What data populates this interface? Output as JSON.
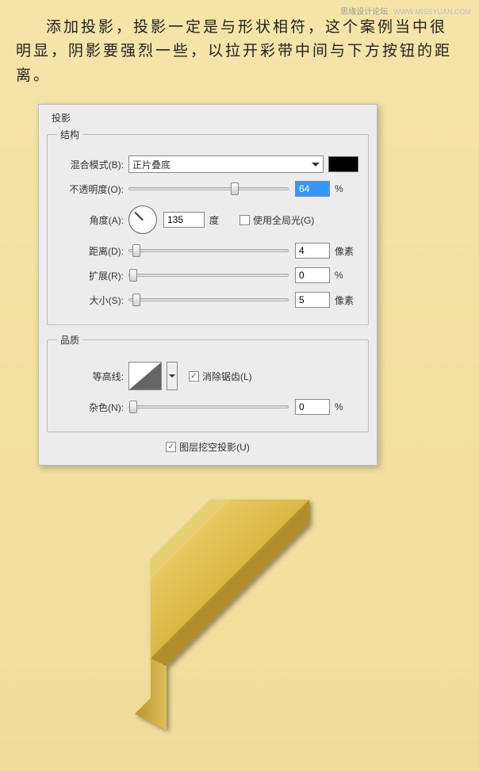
{
  "watermark": {
    "cn": "思缘设计论坛",
    "en": "WWW.MISSYUAN.COM"
  },
  "description": "添加投影，投影一定是与形状相符，这个案例当中很明显，阴影要强烈一些，以拉开彩带中间与下方按钮的距离。",
  "dialog": {
    "title": "投影",
    "structure": {
      "legend": "结构",
      "blend_mode_label": "混合模式(B):",
      "blend_mode_value": "正片叠底",
      "opacity_label": "不透明度(O):",
      "opacity_value": "64",
      "opacity_unit": "%",
      "angle_label": "角度(A):",
      "angle_value": "135",
      "angle_unit": "度",
      "global_light_label": "使用全局光(G)",
      "global_light_checked": false,
      "distance_label": "距离(D):",
      "distance_value": "4",
      "distance_unit": "像素",
      "spread_label": "扩展(R):",
      "spread_value": "0",
      "spread_unit": "%",
      "size_label": "大小(S):",
      "size_value": "5",
      "size_unit": "像素"
    },
    "quality": {
      "legend": "品质",
      "contour_label": "等高线:",
      "antialias_label": "消除锯齿(L)",
      "antialias_checked": true,
      "noise_label": "杂色(N):",
      "noise_value": "0",
      "noise_unit": "%"
    },
    "knockout_label": "图层挖空投影(U)",
    "knockout_checked": true
  },
  "slider_positions": {
    "opacity": 64,
    "distance": 3,
    "spread": 0,
    "size": 3,
    "noise": 0
  }
}
